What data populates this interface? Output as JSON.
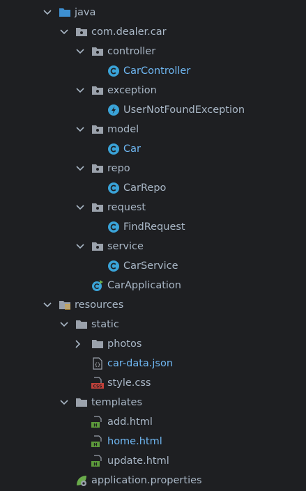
{
  "tree": {
    "rows": [
      {
        "label": "java",
        "icon": "source-folder-icon",
        "expanded": true
      },
      {
        "label": "com.dealer.car",
        "icon": "package-icon",
        "expanded": true
      },
      {
        "label": "controller",
        "icon": "package-icon",
        "expanded": true
      },
      {
        "label": "CarController",
        "icon": "java-class-icon",
        "status": "modified"
      },
      {
        "label": "exception",
        "icon": "package-icon",
        "expanded": true
      },
      {
        "label": "UserNotFoundException",
        "icon": "exception-class-icon"
      },
      {
        "label": "model",
        "icon": "package-icon",
        "expanded": true
      },
      {
        "label": "Car",
        "icon": "java-class-icon",
        "status": "modified"
      },
      {
        "label": "repo",
        "icon": "package-icon",
        "expanded": true
      },
      {
        "label": "CarRepo",
        "icon": "java-class-icon"
      },
      {
        "label": "request",
        "icon": "package-icon",
        "expanded": true
      },
      {
        "label": "FindRequest",
        "icon": "java-class-icon"
      },
      {
        "label": "service",
        "icon": "package-icon",
        "expanded": true
      },
      {
        "label": "CarService",
        "icon": "java-class-icon"
      },
      {
        "label": "CarApplication",
        "icon": "spring-boot-app-icon"
      },
      {
        "label": "resources",
        "icon": "resources-folder-icon",
        "expanded": true
      },
      {
        "label": "static",
        "icon": "folder-icon",
        "expanded": true
      },
      {
        "label": "photos",
        "icon": "folder-icon",
        "expanded": false
      },
      {
        "label": "car-data.json",
        "icon": "json-file-icon",
        "status": "modified"
      },
      {
        "label": "style.css",
        "icon": "css-file-icon"
      },
      {
        "label": "templates",
        "icon": "folder-icon",
        "expanded": true
      },
      {
        "label": "add.html",
        "icon": "html-file-icon"
      },
      {
        "label": "home.html",
        "icon": "html-file-icon",
        "status": "modified"
      },
      {
        "label": "update.html",
        "icon": "html-file-icon"
      },
      {
        "label": "application.properties",
        "icon": "properties-file-icon"
      }
    ]
  },
  "colors": {
    "background": "#1e1f22",
    "text_default": "#a9b7c6",
    "text_modified": "#6fb7f2",
    "chevron": "#a9b7c6",
    "folder": "#9aa1ab",
    "source_folder": "#3d8fd1",
    "class_icon": "#3aa3d8",
    "css_badge": "#c1413a",
    "html_badge": "#5c9a3b",
    "spring_green": "#6aab4b"
  }
}
